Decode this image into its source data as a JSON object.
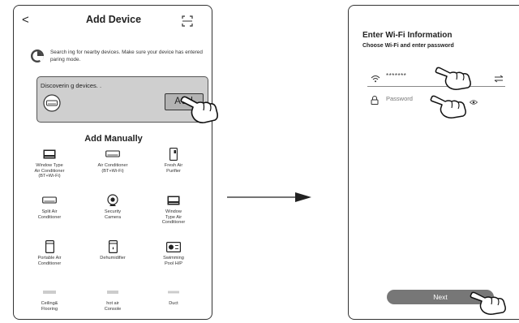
{
  "left": {
    "header": {
      "back_glyph": "<",
      "title": "Add Device"
    },
    "searching_text": "Search ing for nearby devices. Make sure your device has entered paring mode.",
    "discover": {
      "text": "Discoverin g devices. .",
      "add_label": "Add"
    },
    "manual_title": "Add Manually",
    "devices": [
      {
        "label": "Window Type\nAir Conditioner\n(BT+Wi-Fi)",
        "icon": "window-ac-icon"
      },
      {
        "label": "Air Conditioner\n(BT+Wi-Fi)",
        "icon": "split-ac-icon"
      },
      {
        "label": "Fresh Air\nPurifier",
        "icon": "purifier-icon"
      },
      {
        "label": "Split Air\nConditioner",
        "icon": "split-ac-icon"
      },
      {
        "label": "Security\nCamera",
        "icon": "camera-icon"
      },
      {
        "label": "Window\nType Air\nConditioner",
        "icon": "window-ac-icon"
      },
      {
        "label": "Portable Air\nConditioner",
        "icon": "portable-ac-icon"
      },
      {
        "label": "Dehumidifier",
        "icon": "dehumidifier-icon"
      },
      {
        "label": "Swimming\nPool H/P",
        "icon": "pool-hp-icon"
      },
      {
        "label": "Ceiling&\nFlooring",
        "icon": "ceiling-icon"
      },
      {
        "label": "hot air\nConsole",
        "icon": "console-icon"
      },
      {
        "label": "Duct",
        "icon": "duct-icon"
      }
    ]
  },
  "right": {
    "title": "Enter Wi-Fi Information",
    "subtitle": "Choose Wi-Fi and enter password",
    "ssid_value": "*******",
    "password_placeholder": "Password",
    "next_label": "Next"
  }
}
